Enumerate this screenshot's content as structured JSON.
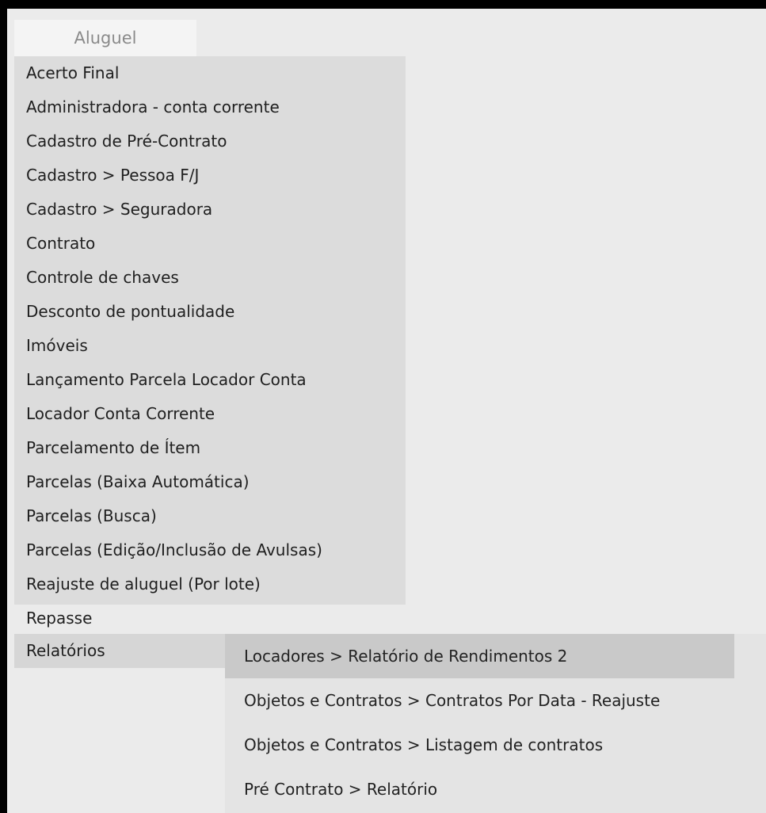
{
  "menu": {
    "title": "Aluguel",
    "items": [
      {
        "label": "Acerto Final"
      },
      {
        "label": "Administradora - conta corrente"
      },
      {
        "label": "Cadastro de Pré-Contrato"
      },
      {
        "label": "Cadastro > Pessoa F/J"
      },
      {
        "label": "Cadastro > Seguradora"
      },
      {
        "label": "Contrato"
      },
      {
        "label": "Controle de chaves"
      },
      {
        "label": "Desconto de pontualidade"
      },
      {
        "label": "Imóveis"
      },
      {
        "label": "Lançamento Parcela Locador Conta"
      },
      {
        "label": "Locador Conta Corrente"
      },
      {
        "label": "Parcelamento de Ítem"
      },
      {
        "label": "Parcelas (Baixa Automática)"
      },
      {
        "label": "Parcelas (Busca)"
      },
      {
        "label": "Parcelas (Edição/Inclusão de Avulsas)"
      },
      {
        "label": "Reajuste de aluguel (Por lote)"
      },
      {
        "label": "Repasse"
      }
    ],
    "selected": {
      "label": "Relatórios"
    }
  },
  "submenu": {
    "items": [
      {
        "label": "Locadores > Relatório de Rendimentos 2"
      },
      {
        "label": "Objetos e Contratos > Contratos Por Data - Reajuste"
      },
      {
        "label": "Objetos e Contratos > Listagem de contratos"
      },
      {
        "label": "Pré Contrato > Relatório"
      }
    ]
  }
}
